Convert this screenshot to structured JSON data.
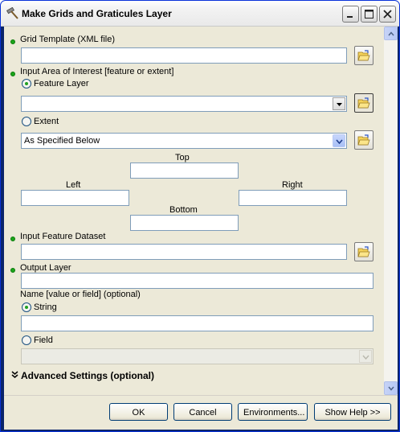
{
  "window": {
    "title": "Make Grids and Graticules Layer",
    "icon": "hammer-icon"
  },
  "params": {
    "grid_template": {
      "label": "Grid Template (XML file)",
      "value": ""
    },
    "area_of_interest": {
      "label": "Input Area of Interest [feature or extent]",
      "feature_layer_label": "Feature Layer",
      "feature_layer_value": "",
      "extent_label": "Extent",
      "extent_value": "As Specified Below",
      "top_label": "Top",
      "left_label": "Left",
      "right_label": "Right",
      "bottom_label": "Bottom",
      "top_value": "",
      "left_value": "",
      "right_value": "",
      "bottom_value": "",
      "selected": "Feature Layer"
    },
    "input_feature_dataset": {
      "label": "Input Feature Dataset",
      "value": ""
    },
    "output_layer": {
      "label": "Output Layer",
      "value": ""
    },
    "name": {
      "label": "Name [value or field] (optional)",
      "string_label": "String",
      "string_value": "",
      "field_label": "Field",
      "field_value": "",
      "selected": "String"
    },
    "advanced": {
      "label": "Advanced Settings (optional)"
    }
  },
  "buttons": {
    "ok": "OK",
    "cancel": "Cancel",
    "environments": "Environments...",
    "show_help": "Show Help >>"
  },
  "colors": {
    "required_dot": "#1ba51b",
    "dialog_bg": "#ece9d8",
    "field_border": "#7f9db9"
  }
}
